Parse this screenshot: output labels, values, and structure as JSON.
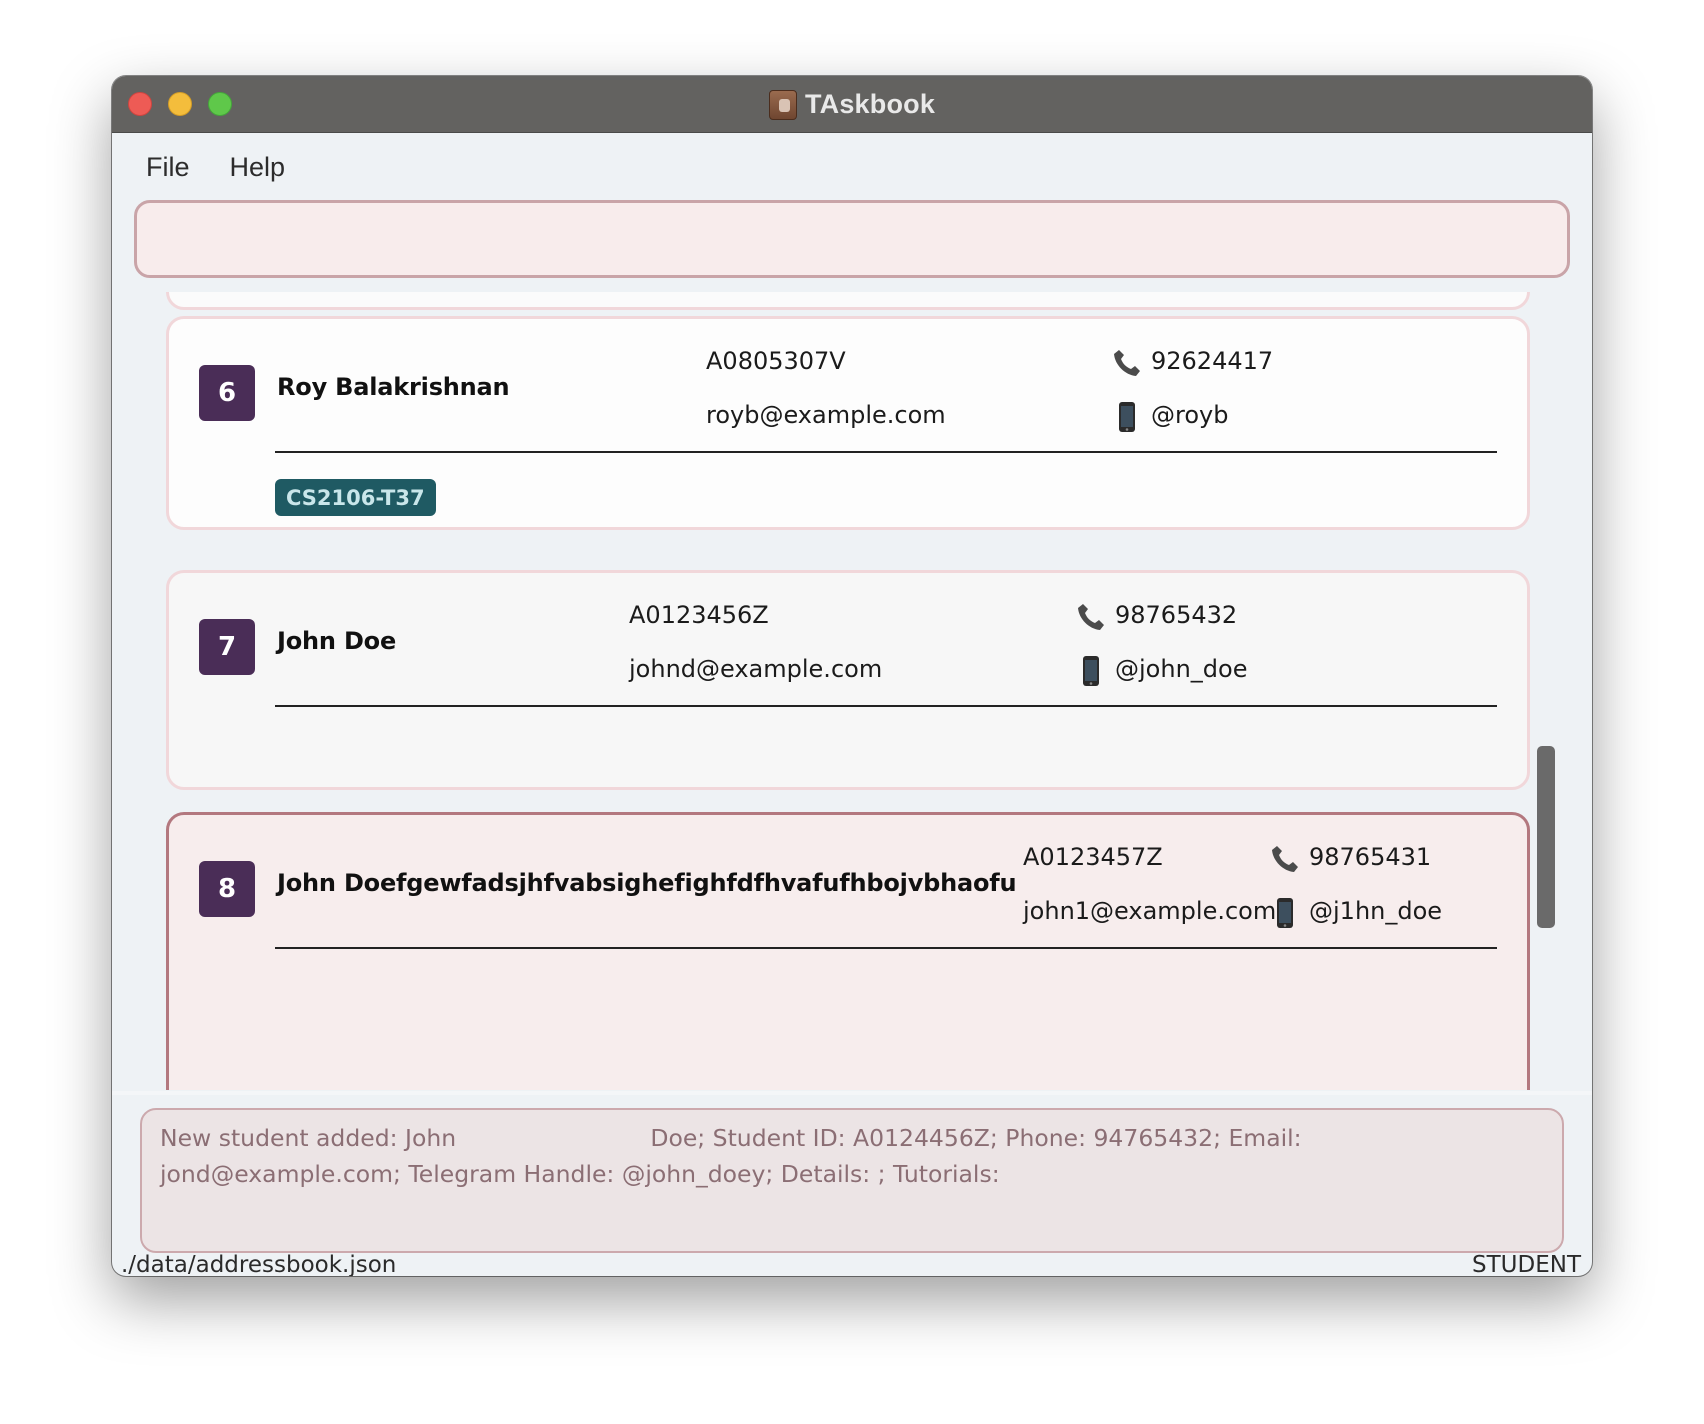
{
  "window": {
    "title": "TAskbook"
  },
  "menu": {
    "file": "File",
    "help": "Help"
  },
  "command": {
    "value": "",
    "placeholder": ""
  },
  "students": [
    {
      "index": "6",
      "name": "Roy Balakrishnan",
      "student_id": "A0805307V",
      "email": "royb@example.com",
      "phone": "92624417",
      "telegram": "@royb",
      "tags": [
        "CS2106-T37"
      ]
    },
    {
      "index": "7",
      "name": "John Doe",
      "student_id": "A0123456Z",
      "email": "johnd@example.com",
      "phone": "98765432",
      "telegram": "@john_doe",
      "tags": []
    },
    {
      "index": "8",
      "name": "John Doefgewfadsjhfvabsighefighfdfhvafufhbojvbhaofu",
      "student_id": "A0123457Z",
      "email": "john1@example.com",
      "phone": "98765431",
      "telegram": "@j1hn_doe",
      "tags": []
    }
  ],
  "result": {
    "message": "New student added: John                          Doe; Student ID: A0124456Z; Phone: 94765432; Email:\njond@example.com; Telegram Handle: @john_doey; Details: ; Tutorials:"
  },
  "status": {
    "file_path": "./data/addressbook.json",
    "mode": "STUDENT"
  },
  "colors": {
    "index_badge": "#4a2d57",
    "tag": "#1f5a63",
    "selected_border": "#b3787f",
    "card_border": "#f1d7da",
    "command_border": "#c9a4a8"
  }
}
